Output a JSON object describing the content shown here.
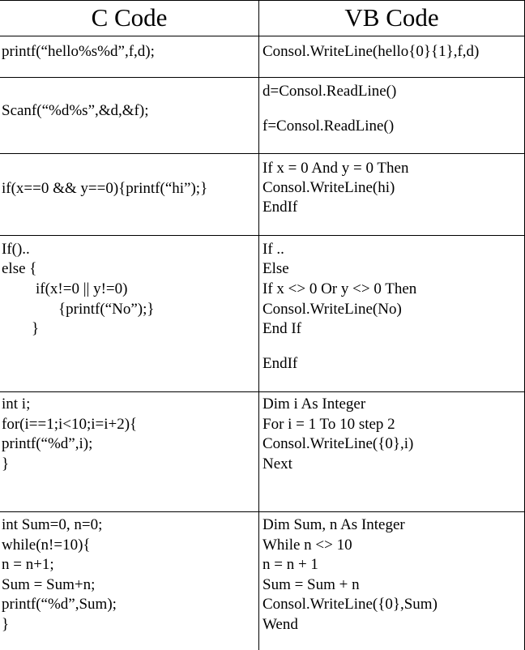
{
  "headers": {
    "c": "C Code",
    "vb": "VB Code"
  },
  "rows": [
    {
      "c": [
        "printf(“hello%s%d”,f,d);"
      ],
      "vb": [
        "Consol.WriteLine(hello{0}{1},f,d)"
      ]
    },
    {
      "c": [
        "Scanf(“%d%s”,&d,&f);"
      ],
      "vb": [
        "d=Consol.ReadLine()",
        "f=Consol.ReadLine()"
      ]
    },
    {
      "c": [
        "if(x==0 && y==0){printf(“hi”);}"
      ],
      "vb": [
        "If x = 0 And y = 0 Then",
        "Consol.WriteLine(hi)",
        "EndIf"
      ]
    },
    {
      "c": [
        "If()..",
        "else {",
        "if(x!=0 || y!=0)",
        "{printf(“No”);}",
        "}"
      ],
      "vb": [
        "If ..",
        "Else",
        "If x <> 0 Or y <> 0 Then",
        "Consol.WriteLine(No)",
        "End If",
        "EndIf"
      ]
    },
    {
      "c": [
        "int i;",
        "for(i==1;i<10;i=i+2){",
        "printf(“%d”,i);",
        "}"
      ],
      "vb": [
        "Dim i As Integer",
        "For i = 1 To 10 step 2",
        "Consol.WriteLine({0},i)",
        "Next"
      ]
    },
    {
      "c": [
        "int Sum=0, n=0;",
        "while(n!=10){",
        "n = n+1;",
        "Sum = Sum+n;",
        "printf(“%d”,Sum);",
        "}"
      ],
      "vb": [
        "Dim Sum, n As Integer",
        "While n <> 10",
        "n = n + 1",
        "Sum = Sum + n",
        "Consol.WriteLine({0},Sum)",
        "Wend"
      ]
    }
  ]
}
